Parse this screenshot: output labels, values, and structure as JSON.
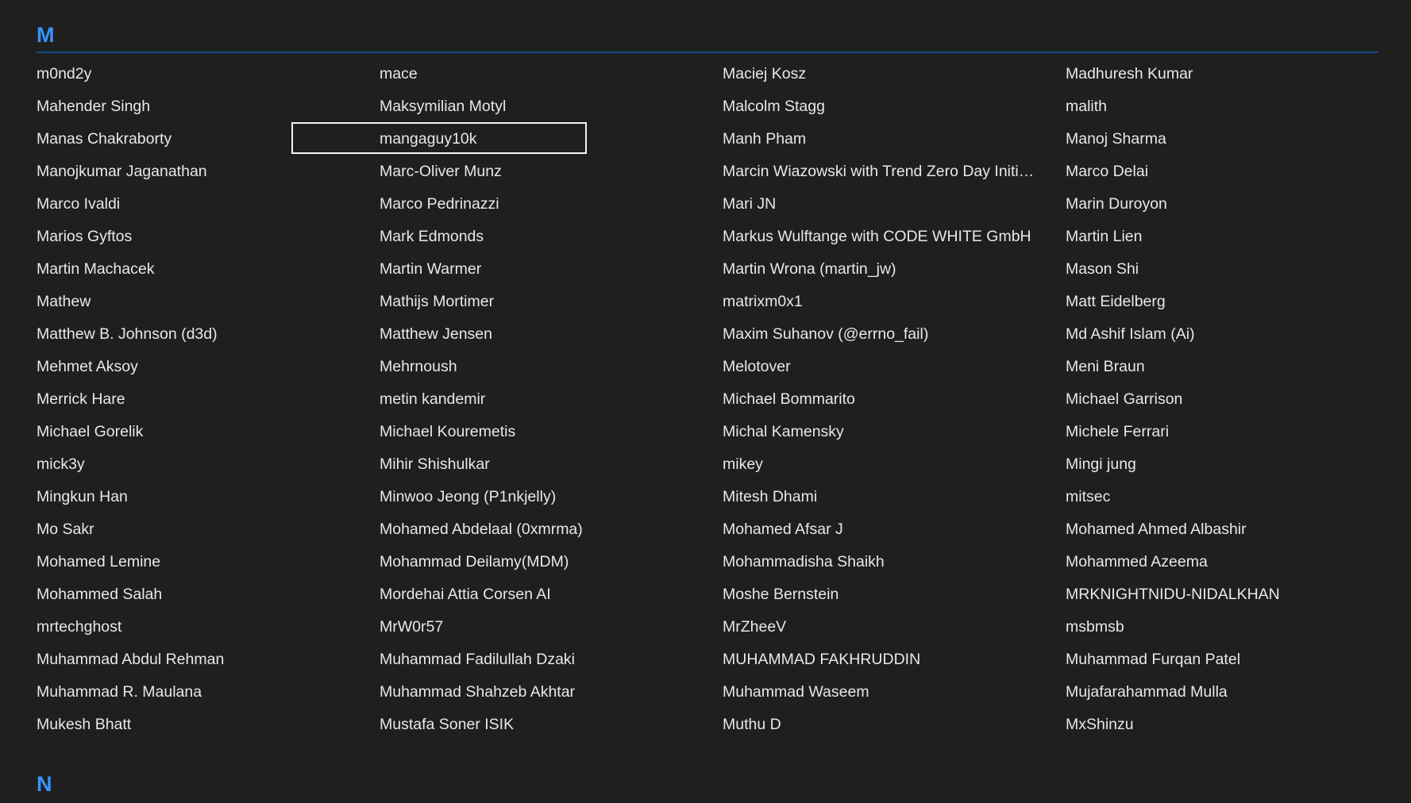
{
  "sections": [
    {
      "letter": "M",
      "names": [
        "m0nd2y",
        "mace",
        "Maciej Kosz",
        "Madhuresh Kumar",
        "Mahender Singh",
        "Maksymilian Motyl",
        "Malcolm Stagg",
        "malith",
        "Manas Chakraborty",
        "mangaguy10k",
        "Manh Pham",
        "Manoj Sharma",
        "Manojkumar Jaganathan",
        "Marc-Oliver Munz",
        "Marcin Wiazowski with Trend Zero Day Initiative",
        "Marco Delai",
        "Marco Ivaldi",
        "Marco Pedrinazzi",
        "Mari JN",
        "Marin Duroyon",
        "Marios Gyftos",
        "Mark Edmonds",
        "Markus Wulftange with CODE WHITE GmbH",
        "Martin Lien",
        "Martin Machacek",
        "Martin Warmer",
        "Martin Wrona (martin_jw)",
        "Mason Shi",
        "Mathew",
        "Mathijs Mortimer",
        "matrixm0x1",
        "Matt Eidelberg",
        "Matthew B. Johnson (d3d)",
        "Matthew Jensen",
        "Maxim Suhanov (@errno_fail)",
        "Md Ashif Islam (Ai)",
        "Mehmet Aksoy",
        "Mehrnoush",
        "Melotover",
        "Meni Braun",
        "Merrick Hare",
        "metin kandemir",
        "Michael Bommarito",
        "Michael Garrison",
        "Michael Gorelik",
        "Michael Kouremetis",
        "Michal Kamensky",
        "Michele Ferrari",
        "mick3y",
        "Mihir Shishulkar",
        "mikey",
        "Mingi jung",
        "Mingkun Han",
        "Minwoo Jeong (P1nkjelly)",
        "Mitesh Dhami",
        "mitsec",
        "Mo Sakr",
        "Mohamed Abdelaal (0xmrma)",
        "Mohamed Afsar J",
        "Mohamed Ahmed Albashir",
        "Mohamed Lemine",
        "Mohammad Deilamy(MDM)",
        "Mohammadisha Shaikh",
        "Mohammed Azeema",
        "Mohammed Salah",
        "Mordehai Attia Corsen AI",
        "Moshe Bernstein",
        "MRKNIGHTNIDU-NIDALKHAN",
        "mrtechghost",
        "MrW0r57",
        "MrZheeV",
        "msbmsb",
        "Muhammad Abdul Rehman",
        "Muhammad Fadilullah Dzaki",
        "MUHAMMAD FAKHRUDDIN",
        "Muhammad Furqan Patel",
        "Muhammad R. Maulana",
        "Muhammad Shahzeb Akhtar",
        "Muhammad Waseem",
        "Mujafarahammad Mulla",
        "Mukesh Bhatt",
        "Mustafa Soner ISIK",
        "Muthu D",
        "MxShinzu"
      ],
      "focused_index": 9
    },
    {
      "letter": "N",
      "names": []
    }
  ]
}
